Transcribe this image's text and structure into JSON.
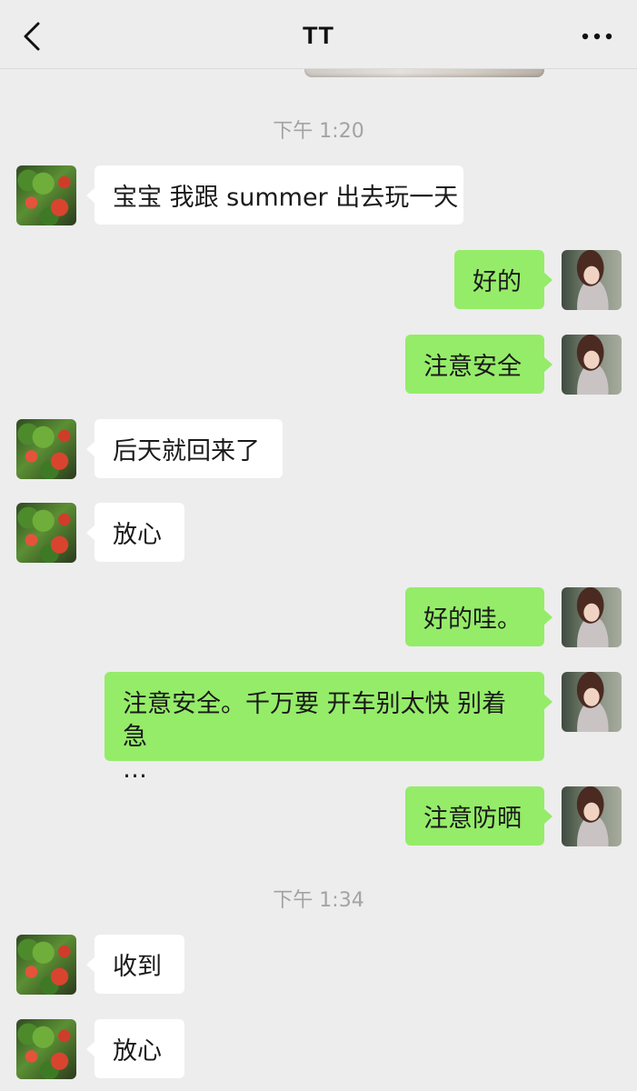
{
  "header": {
    "title": "TT"
  },
  "icons": {
    "back": "chevron-left-icon",
    "more": "more-dots-icon"
  },
  "colors": {
    "background": "#ededed",
    "sent_bubble": "#95ec69",
    "received_bubble": "#ffffff",
    "timestamp": "#a3a3a3"
  },
  "chat": {
    "timestamps": [
      "下午 1:20",
      "下午 1:34"
    ],
    "messages": [
      {
        "side": "left",
        "text": "宝宝 我跟 summer 出去玩一天"
      },
      {
        "side": "right",
        "text": "好的"
      },
      {
        "side": "right",
        "text": "注意安全"
      },
      {
        "side": "left",
        "text": "后天就回来了"
      },
      {
        "side": "left",
        "text": "放心"
      },
      {
        "side": "right",
        "text": "好的哇。"
      },
      {
        "side": "right",
        "line1": "注意安全。千万要 开车别太快 别着急",
        "line2": "…"
      },
      {
        "side": "right",
        "text": "注意防晒"
      },
      {
        "side": "left",
        "text": "收到"
      },
      {
        "side": "left",
        "text": "放心"
      }
    ]
  }
}
